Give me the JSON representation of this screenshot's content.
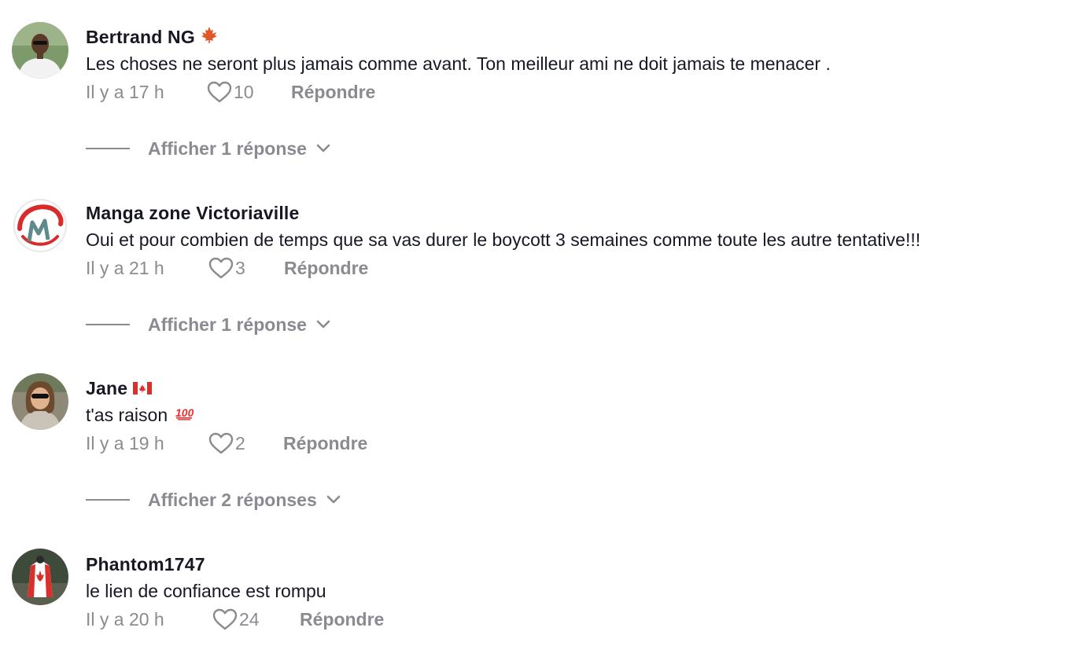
{
  "comments": [
    {
      "avatar": "avatar-man-sunglasses",
      "username": "Bertrand NG",
      "badge": "maple-leaf-icon",
      "text": "Les choses ne seront plus jamais comme avant. Ton meilleur ami ne doit jamais te menacer .",
      "time": "Il y a 17 h",
      "likes": "10",
      "reply_label": "Répondre",
      "view_replies": "Afficher 1 réponse"
    },
    {
      "avatar": "avatar-manga-logo",
      "username": "Manga zone Victoriaville",
      "badge": "",
      "text": "Oui et pour combien de temps que sa vas durer le boycott 3 semaines comme toute les autre tentative!!!",
      "time": "Il y a 21 h",
      "likes": "3",
      "reply_label": "Répondre",
      "view_replies": "Afficher 1 réponse"
    },
    {
      "avatar": "avatar-woman-sunglasses",
      "username": "Jane",
      "badge": "canada-flag-icon",
      "text": "t'as raison",
      "text_emoji": "hundred-points-icon",
      "time": "Il y a 19 h",
      "likes": "2",
      "reply_label": "Répondre",
      "view_replies": "Afficher 2 réponses"
    },
    {
      "avatar": "avatar-canada-flag-person",
      "username": "Phantom1747",
      "badge": "",
      "text": "le lien de confiance est rompu",
      "time": "Il y a 20 h",
      "likes": "24",
      "reply_label": "Répondre"
    }
  ],
  "colors": {
    "primary_text": "#161823",
    "secondary_text": "#8a8b91",
    "maple_red": "#d9302b"
  }
}
